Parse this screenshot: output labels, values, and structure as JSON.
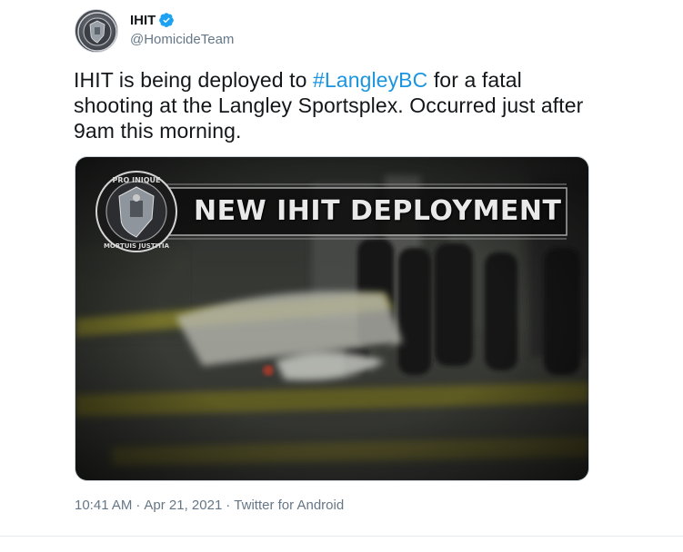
{
  "author": {
    "display_name": "IHIT",
    "handle": "@HomicideTeam",
    "verified": true,
    "avatar_icon": "police-crest-icon",
    "verified_icon": "verified-badge-icon"
  },
  "tweet": {
    "text_before": "IHIT is being deployed to ",
    "hashtag": "#LangleyBC",
    "text_after": " for a fatal shooting at the Langley Sportsplex. Occurred just after 9am this morning."
  },
  "media": {
    "banner_title": "NEW IHIT DEPLOYMENT",
    "crest_top_text": "PRO INIQUE",
    "crest_bottom_text": "MORTUIS JUSTITIA"
  },
  "meta": {
    "time": "10:41 AM",
    "date": "Apr 21, 2021",
    "source": "Twitter for Android",
    "separator": "·"
  },
  "colors": {
    "link": "#1b95e0",
    "verified": "#1da1f2",
    "text": "#14171a",
    "secondary": "#657786"
  }
}
